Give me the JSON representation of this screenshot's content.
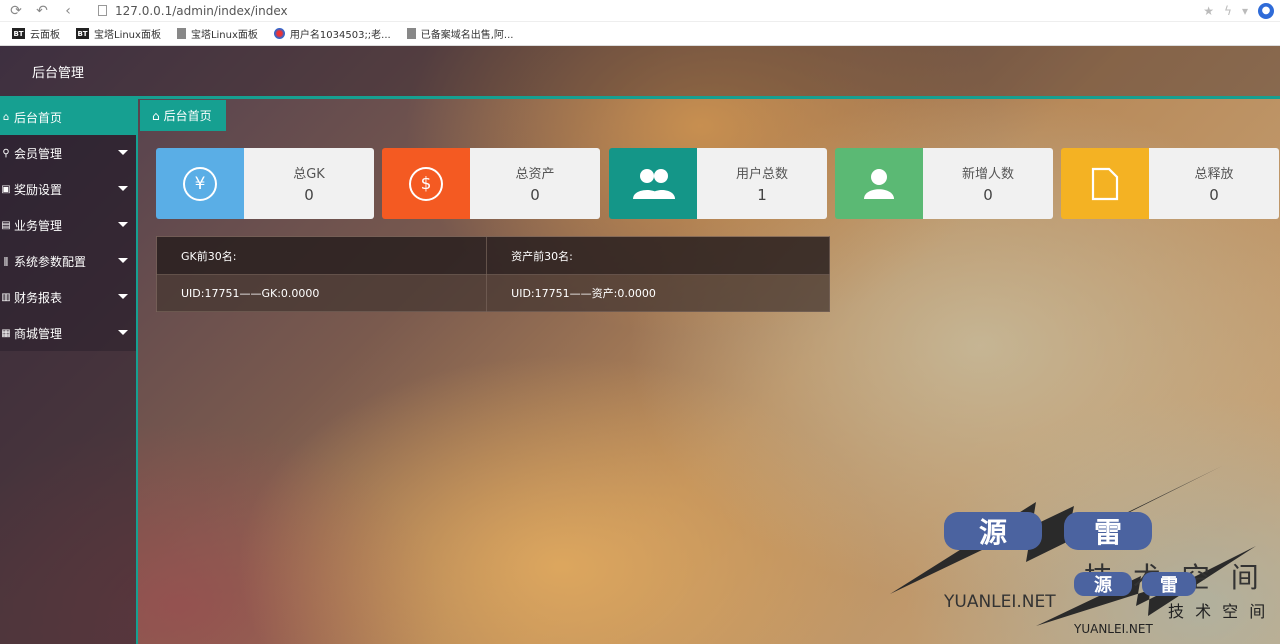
{
  "browser": {
    "url": "127.0.0.1/admin/index/index",
    "bookmarks": [
      {
        "badge": "BT",
        "label": "云面板"
      },
      {
        "badge": "BT",
        "label": "宝塔Linux面板"
      },
      {
        "badge": "",
        "label": "宝塔Linux面板"
      },
      {
        "badge": "",
        "label": "用户名1034503\u0000老..."
      },
      {
        "badge": "",
        "label": "已备案域名出售,阿..."
      }
    ]
  },
  "header": {
    "title": "后台管理"
  },
  "sidebar": {
    "items": [
      {
        "label": "后台首页",
        "icon": "home-icon",
        "active": true
      },
      {
        "label": "会员管理",
        "icon": "users-icon"
      },
      {
        "label": "奖励设置",
        "icon": "gift-icon"
      },
      {
        "label": "业务管理",
        "icon": "briefcase-icon"
      },
      {
        "label": "系统参数配置",
        "icon": "settings-icon"
      },
      {
        "label": "财务报表",
        "icon": "chart-icon"
      },
      {
        "label": "商城管理",
        "icon": "shop-icon"
      }
    ]
  },
  "tab": {
    "label": "后台首页",
    "icon": "home-icon"
  },
  "stats": [
    {
      "label": "总GK",
      "value": "0",
      "color": "#5aaee6",
      "icon": "yen-icon"
    },
    {
      "label": "总资产",
      "value": "0",
      "color": "#f45a22",
      "icon": "dollar-icon"
    },
    {
      "label": "用户总数",
      "value": "1",
      "color": "#149688",
      "icon": "users-icon"
    },
    {
      "label": "新增人数",
      "value": "0",
      "color": "#5bb974",
      "icon": "user-icon"
    },
    {
      "label": "总释放",
      "value": "0",
      "color": "#f4b223",
      "icon": "file-icon"
    }
  ],
  "rank_table": {
    "headers": [
      "GK前30名:",
      "资产前30名:"
    ],
    "rows": [
      [
        "UID:17751——GK:0.0000",
        "UID:17751——资产:0.0000"
      ]
    ]
  },
  "watermark": {
    "chars": [
      "源",
      "雷"
    ],
    "subtitle": "技 术 空 间",
    "domain": "YUANLEI.NET"
  },
  "colors": {
    "accent": "#16a091"
  }
}
